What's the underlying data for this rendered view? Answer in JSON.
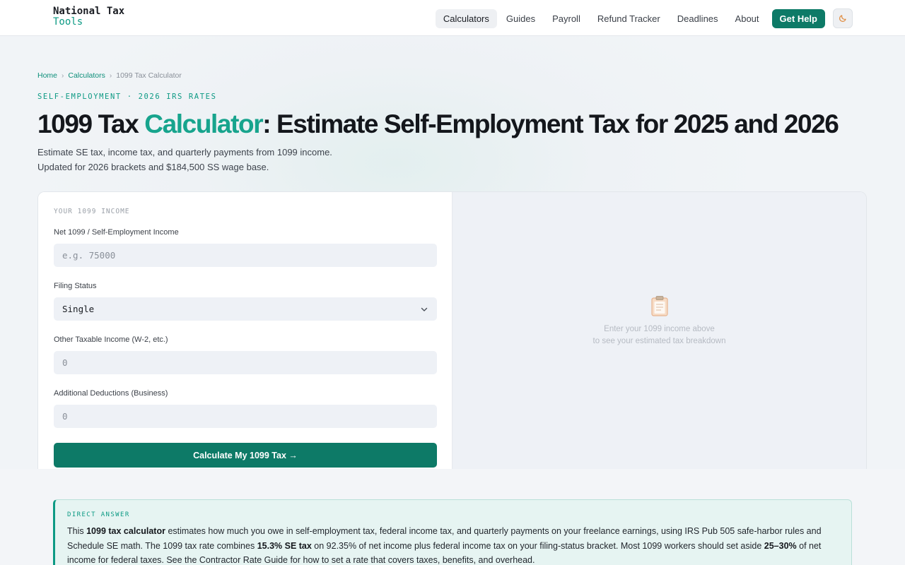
{
  "brand": {
    "line1": "National Tax",
    "line2": "Tools"
  },
  "nav": {
    "items": [
      {
        "label": "Calculators",
        "active": true
      },
      {
        "label": "Guides"
      },
      {
        "label": "Payroll"
      },
      {
        "label": "Refund Tracker"
      },
      {
        "label": "Deadlines"
      },
      {
        "label": "About"
      }
    ],
    "cta": "Get Help",
    "theme_icon": "moon-icon"
  },
  "breadcrumb": {
    "home": "Home",
    "section": "Calculators",
    "current": "1099 Tax Calculator",
    "separator": "›"
  },
  "hero": {
    "eyebrow": "SELF-EMPLOYMENT · 2026 IRS RATES",
    "title_pre": "1099 Tax ",
    "title_accent": "Calculator",
    "title_post": ": Estimate Self-Employment Tax for 2025 and 2026",
    "subtitle_line1": "Estimate SE tax, income tax, and quarterly payments from 1099 income.",
    "subtitle_line2": "Updated for 2026 brackets and $184,500 SS wage base."
  },
  "form": {
    "panel_label": "YOUR 1099 INCOME",
    "income_label": "Net 1099 / Self-Employment Income",
    "income_placeholder": "e.g. 75000",
    "filing_label": "Filing Status",
    "filing_value": "Single",
    "other_label": "Other Taxable Income (W-2, etc.)",
    "other_value": "0",
    "deductions_label": "Additional Deductions (Business)",
    "deductions_value": "0",
    "submit": "Calculate My 1099 Tax →"
  },
  "result": {
    "icon": "clipboard-icon",
    "hint_line1": "Enter your 1099 income above",
    "hint_line2": "to see your estimated tax breakdown"
  },
  "answer": {
    "tag": "DIRECT ANSWER",
    "t1": "This ",
    "b1": "1099 tax calculator",
    "t2": " estimates how much you owe in self-employment tax, federal income tax, and quarterly payments on your freelance earnings, using IRS Pub 505 safe-harbor rules and Schedule SE math. The 1099 tax rate combines ",
    "b2": "15.3% SE tax",
    "t3": " on 92.35% of net income plus federal income tax on your filing-status bracket. Most 1099 workers should set aside ",
    "b3": "25–30%",
    "t4": " of net income for federal taxes. See the Contractor Rate Guide for how to set a rate that covers taxes, benefits, and overhead."
  }
}
